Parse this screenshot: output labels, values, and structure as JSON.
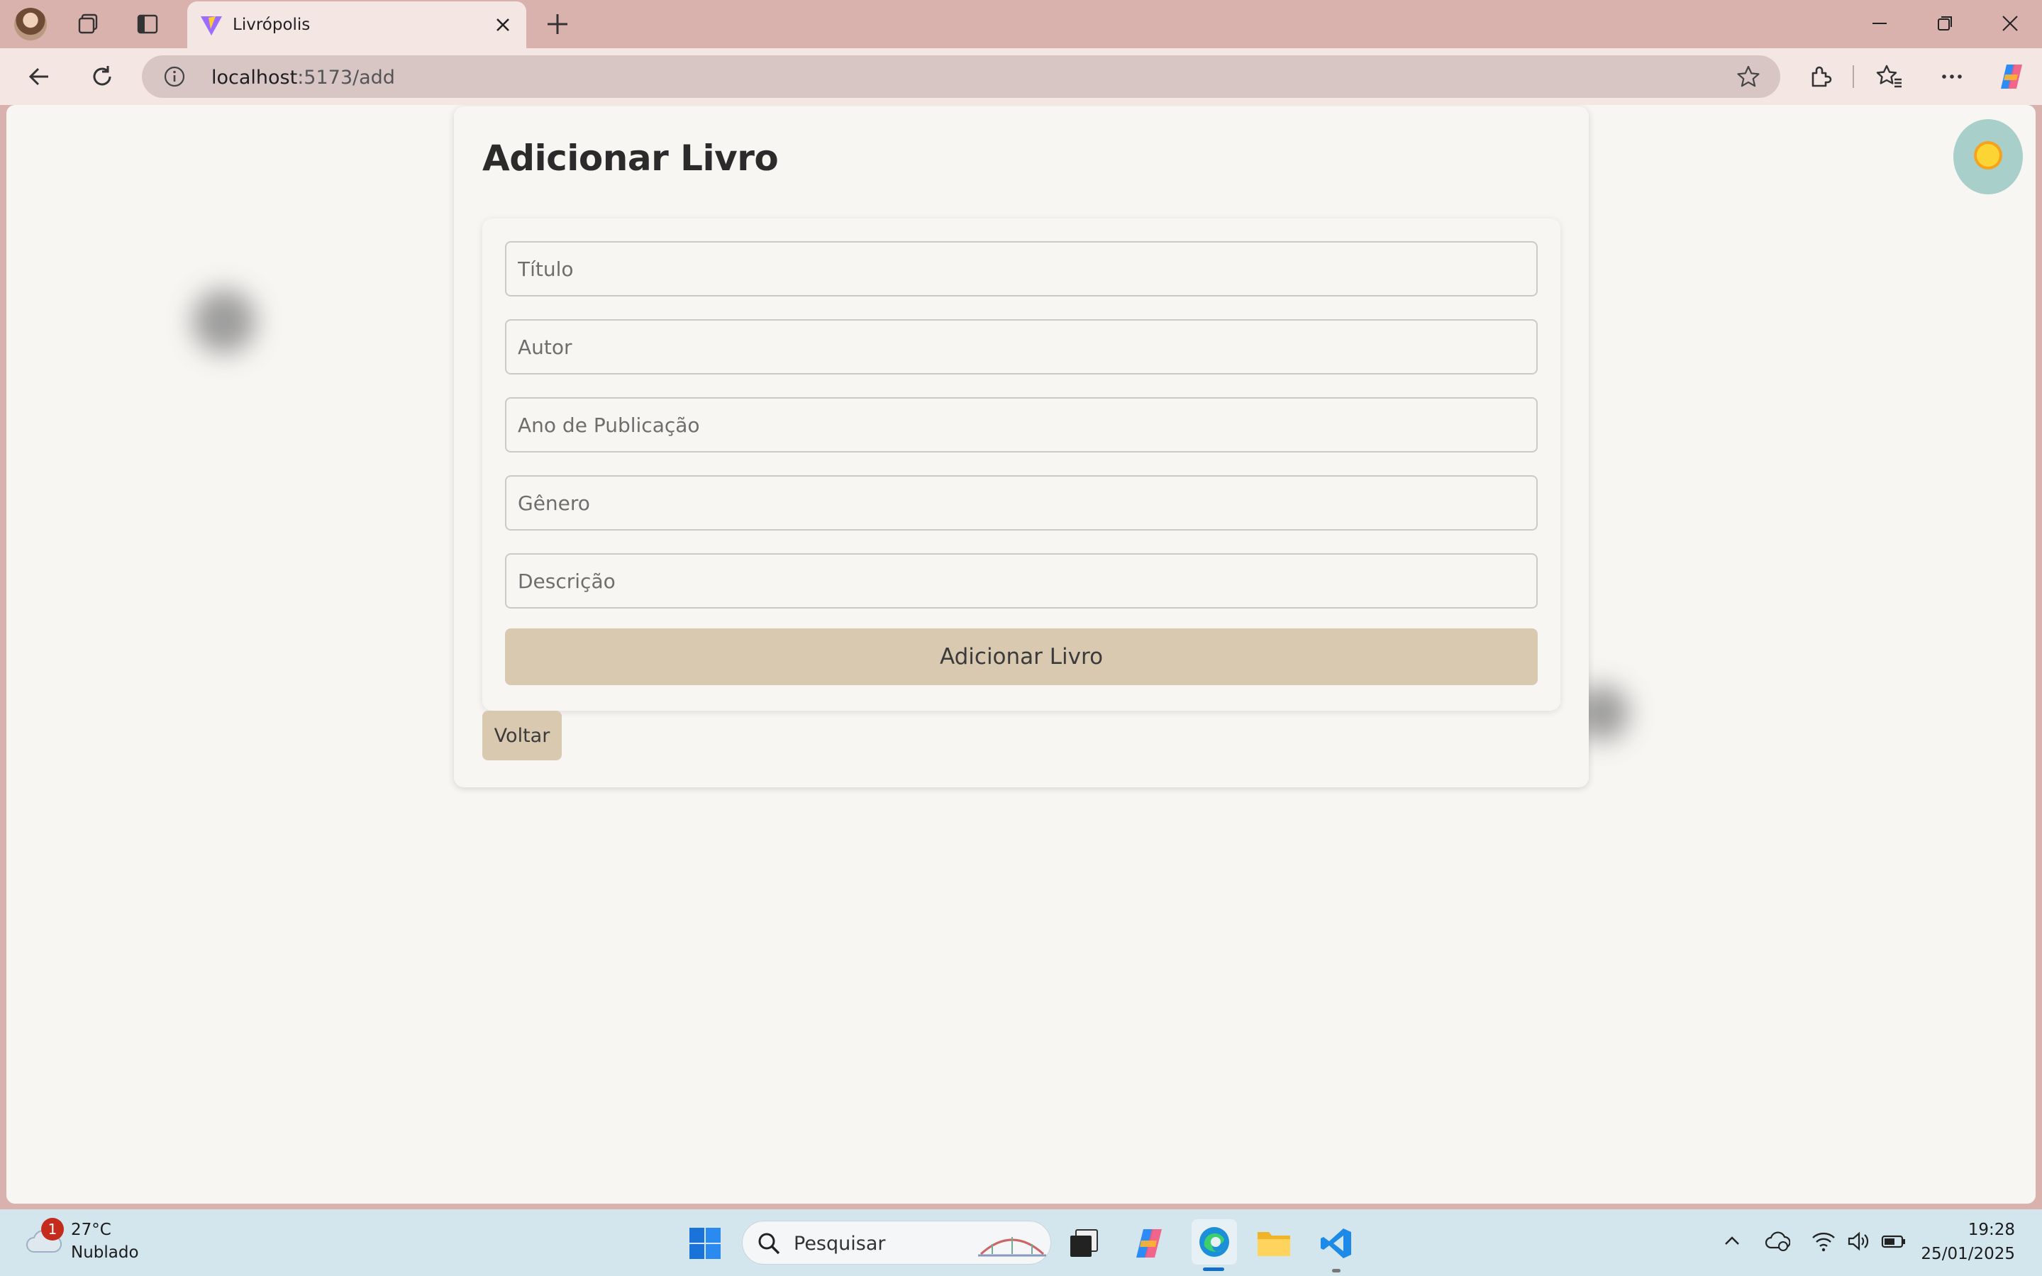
{
  "browser": {
    "tab_title": "Livrópolis",
    "address_host": "localhost",
    "address_path": ":5173/add",
    "icons": [
      "profile-avatar",
      "workspaces-icon",
      "tab-actions-icon",
      "vite-logo-icon",
      "close-icon",
      "plus-icon",
      "minimize-icon",
      "restore-icon",
      "window-close-icon",
      "back-arrow-icon",
      "refresh-icon",
      "info-icon",
      "star-icon",
      "extensions-icon",
      "favorites-icon",
      "more-icon",
      "copilot-icon"
    ]
  },
  "page": {
    "title": "Adicionar Livro",
    "form": {
      "titulo_placeholder": "Título",
      "autor_placeholder": "Autor",
      "ano_placeholder": "Ano de Publicação",
      "genero_placeholder": "Gênero",
      "descricao_placeholder": "Descrição",
      "submit_label": "Adicionar Livro"
    },
    "back_label": "Voltar",
    "colors": {
      "button": "#d9c9b0",
      "theme_toggle": "#a8cfc9",
      "sun": "#f9c11f"
    }
  },
  "taskbar": {
    "weather_temp": "27°C",
    "weather_condition": "Nublado",
    "weather_badge": "1",
    "search_placeholder": "Pesquisar",
    "time": "19:28",
    "date": "25/01/2025"
  }
}
